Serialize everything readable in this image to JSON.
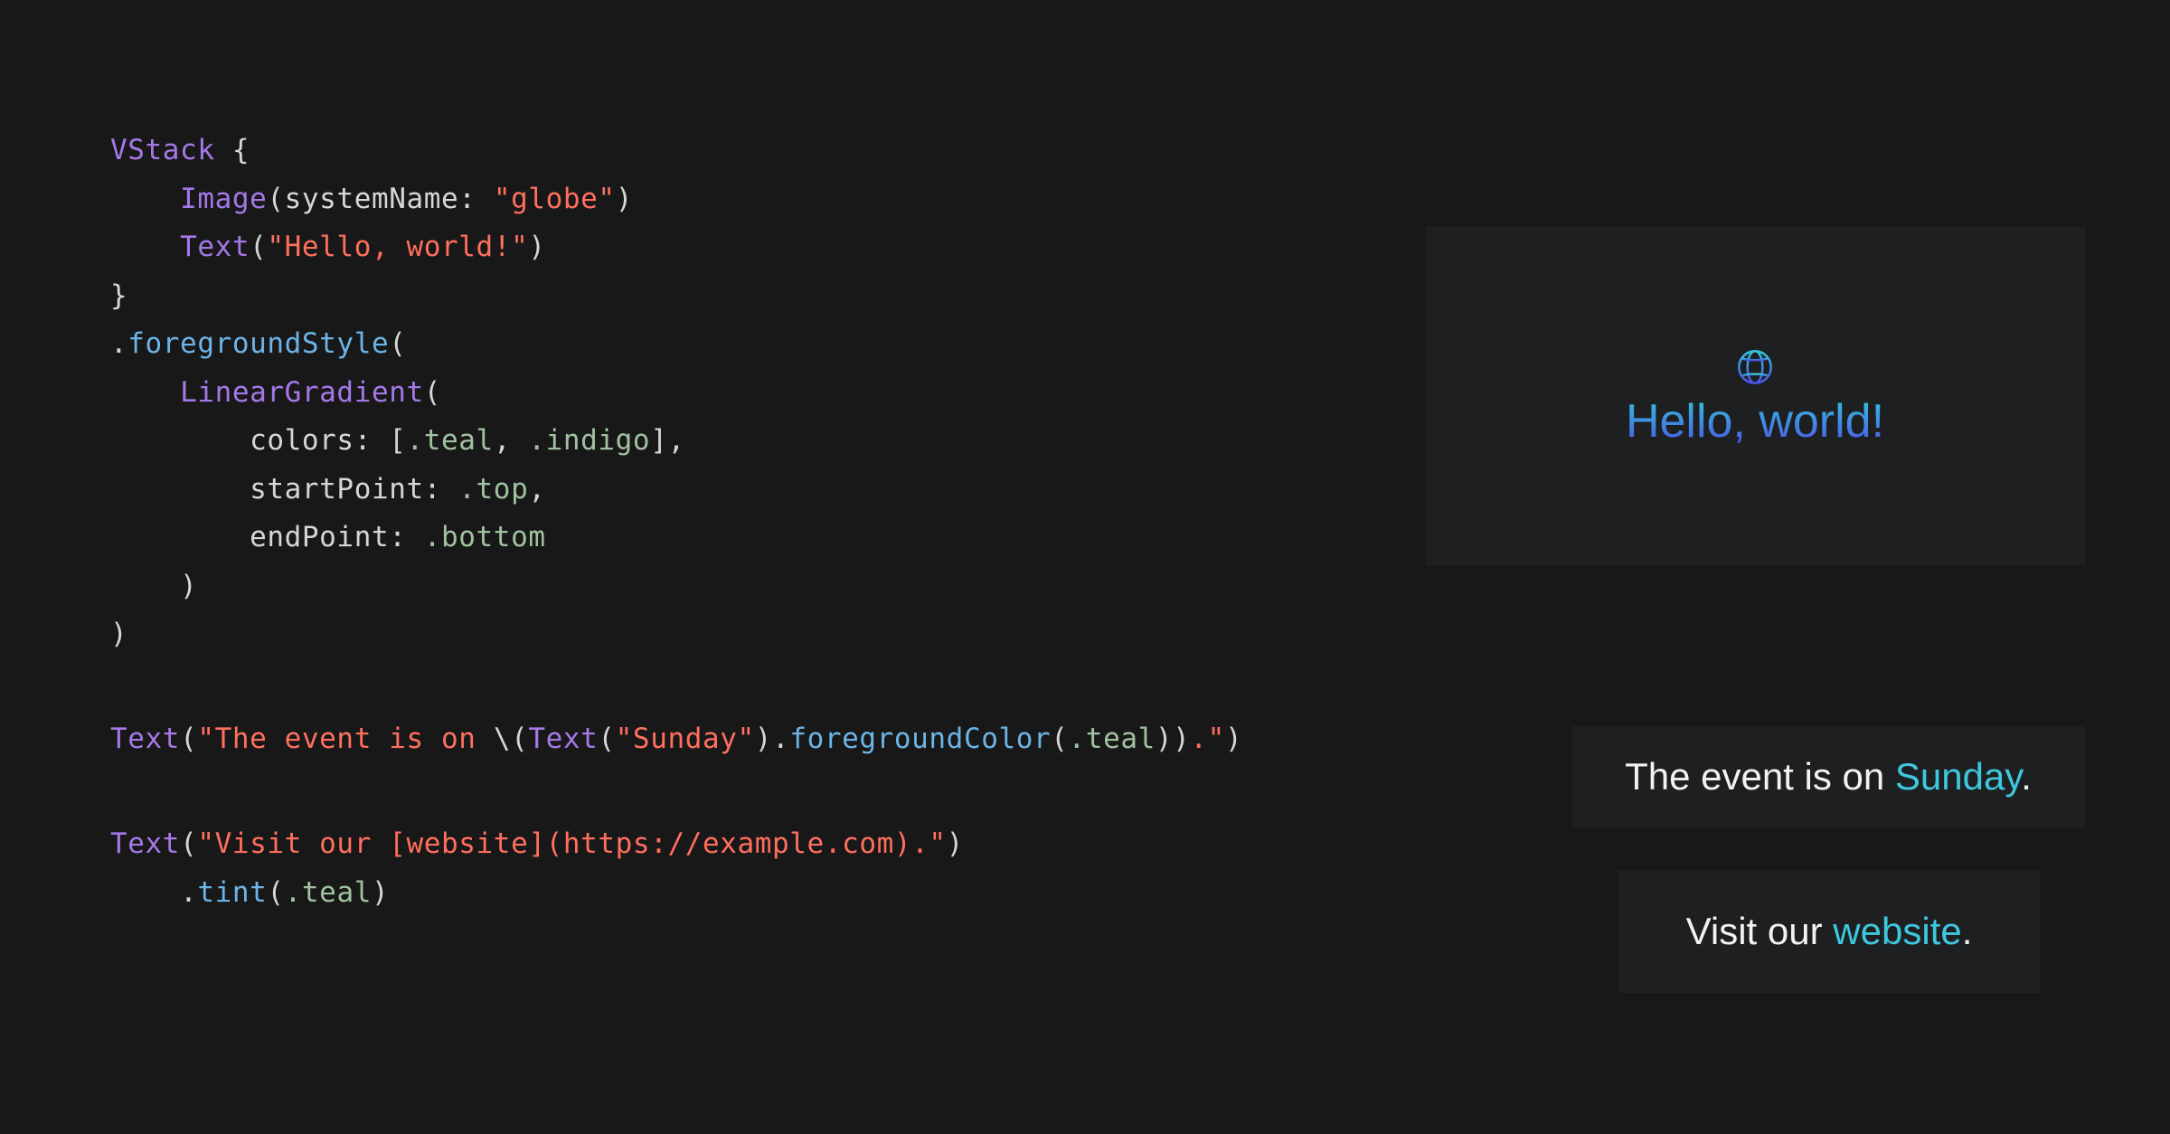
{
  "theme": {
    "background": "#181818",
    "card_background": "#1e1f21",
    "code_plain": "#d6d6d6",
    "code_type": "#a578e8",
    "code_method": "#6cb4e8",
    "code_string": "#ff6f5e",
    "code_enum": "#a1c2a1",
    "preview_text": "#f2f2f2",
    "accent_teal": "#3ec8de",
    "accent_indigo": "#4b52e8"
  },
  "code": {
    "block1": {
      "lines": [
        {
          "id": "l1",
          "indent": 0,
          "tokens": [
            {
              "t": "VStack",
              "c": "type"
            },
            {
              "t": " {",
              "c": "punct"
            }
          ]
        },
        {
          "id": "l2",
          "indent": 1,
          "tokens": [
            {
              "t": "Image",
              "c": "type"
            },
            {
              "t": "(systemName: ",
              "c": "plain"
            },
            {
              "t": "\"globe\"",
              "c": "string"
            },
            {
              "t": ")",
              "c": "plain"
            }
          ]
        },
        {
          "id": "l3",
          "indent": 1,
          "tokens": [
            {
              "t": "Text",
              "c": "type"
            },
            {
              "t": "(",
              "c": "plain"
            },
            {
              "t": "\"Hello, world!\"",
              "c": "string"
            },
            {
              "t": ")",
              "c": "plain"
            }
          ]
        },
        {
          "id": "l4",
          "indent": 0,
          "tokens": [
            {
              "t": "}",
              "c": "punct"
            }
          ]
        },
        {
          "id": "l5",
          "indent": 0,
          "tokens": [
            {
              "t": ".",
              "c": "plain"
            },
            {
              "t": "foregroundStyle",
              "c": "method"
            },
            {
              "t": "(",
              "c": "plain"
            }
          ]
        },
        {
          "id": "l6",
          "indent": 1,
          "tokens": [
            {
              "t": "LinearGradient",
              "c": "type"
            },
            {
              "t": "(",
              "c": "plain"
            }
          ]
        },
        {
          "id": "l7",
          "indent": 2,
          "tokens": [
            {
              "t": "colors: [",
              "c": "plain"
            },
            {
              "t": ".teal",
              "c": "enum"
            },
            {
              "t": ", ",
              "c": "plain"
            },
            {
              "t": ".indigo",
              "c": "enum"
            },
            {
              "t": "],",
              "c": "plain"
            }
          ]
        },
        {
          "id": "l8",
          "indent": 2,
          "tokens": [
            {
              "t": "startPoint: ",
              "c": "plain"
            },
            {
              "t": ".top",
              "c": "enum"
            },
            {
              "t": ",",
              "c": "plain"
            }
          ]
        },
        {
          "id": "l9",
          "indent": 2,
          "tokens": [
            {
              "t": "endPoint: ",
              "c": "plain"
            },
            {
              "t": ".bottom",
              "c": "enum"
            }
          ]
        },
        {
          "id": "l10",
          "indent": 1,
          "tokens": [
            {
              "t": ")",
              "c": "punct"
            }
          ]
        },
        {
          "id": "l11",
          "indent": 0,
          "tokens": [
            {
              "t": ")",
              "c": "punct"
            }
          ]
        }
      ]
    },
    "block2": {
      "lines": [
        {
          "id": "l12",
          "indent": 0,
          "tokens": [
            {
              "t": "Text",
              "c": "type"
            },
            {
              "t": "(",
              "c": "plain"
            },
            {
              "t": "\"The event is on ",
              "c": "string"
            },
            {
              "t": "\\(",
              "c": "plain"
            },
            {
              "t": "Text",
              "c": "type"
            },
            {
              "t": "(",
              "c": "plain"
            },
            {
              "t": "\"Sunday\"",
              "c": "string"
            },
            {
              "t": ").",
              "c": "plain"
            },
            {
              "t": "foregroundColor",
              "c": "method"
            },
            {
              "t": "(",
              "c": "plain"
            },
            {
              "t": ".teal",
              "c": "enum"
            },
            {
              "t": "))",
              "c": "plain"
            },
            {
              "t": ".\"",
              "c": "string"
            },
            {
              "t": ")",
              "c": "plain"
            }
          ]
        }
      ]
    },
    "block3": {
      "lines": [
        {
          "id": "l13",
          "indent": 0,
          "tokens": [
            {
              "t": "Text",
              "c": "type"
            },
            {
              "t": "(",
              "c": "plain"
            },
            {
              "t": "\"Visit our [website](https://example.com).\"",
              "c": "string"
            },
            {
              "t": ")",
              "c": "plain"
            }
          ]
        },
        {
          "id": "l14",
          "indent": 1,
          "tokens": [
            {
              "t": ".",
              "c": "plain"
            },
            {
              "t": "tint",
              "c": "method"
            },
            {
              "t": "(",
              "c": "plain"
            },
            {
              "t": ".teal",
              "c": "enum"
            },
            {
              "t": ")",
              "c": "plain"
            }
          ]
        }
      ]
    }
  },
  "previews": {
    "hello": {
      "icon": "globe-icon",
      "label": "Hello, world!",
      "gradient_from": "#34c8dd",
      "gradient_to": "#4b52e8"
    },
    "event": {
      "prefix": "The event is on ",
      "highlight": "Sunday",
      "suffix": "."
    },
    "website": {
      "prefix": "Visit our ",
      "highlight": "website",
      "suffix": "."
    }
  }
}
